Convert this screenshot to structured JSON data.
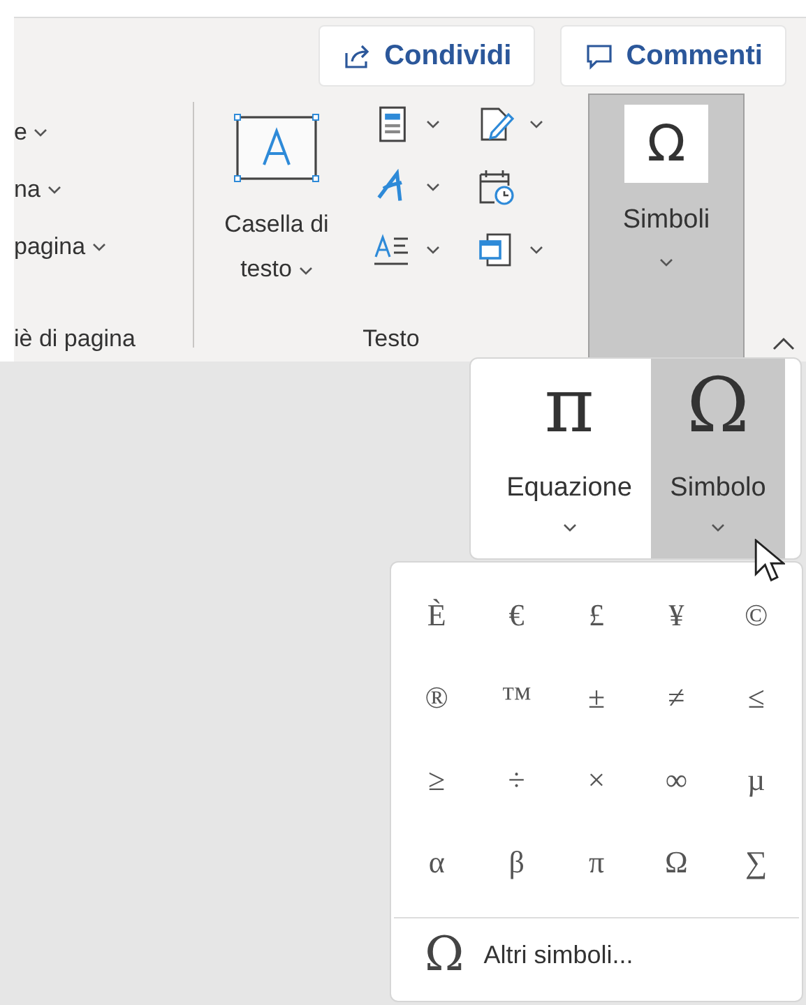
{
  "share_buttons": [
    {
      "kind": "share",
      "label": "Condividi"
    },
    {
      "kind": "comment",
      "label": "Commenti"
    }
  ],
  "ribbon": {
    "cut_group": {
      "items": [
        "e",
        "na",
        "pagina"
      ],
      "label": "iè di pagina"
    },
    "text_group": {
      "text_box": "Casella di testo",
      "label": "Testo"
    },
    "symbols_button": {
      "icon": "Ω",
      "label": "Simboli",
      "selected": true
    }
  },
  "symbols_menu": {
    "items": [
      {
        "icon": "π",
        "label": "Equazione",
        "selected": false
      },
      {
        "icon": "Ω",
        "label": "Simbolo",
        "selected": true
      }
    ]
  },
  "symbol_gallery": {
    "symbols": [
      "È",
      "€",
      "£",
      "¥",
      "©",
      "®",
      "™",
      "±",
      "≠",
      "≤",
      "≥",
      "÷",
      "×",
      "∞",
      "µ",
      "α",
      "β",
      "π",
      "Ω",
      "∑"
    ],
    "more": {
      "icon": "Ω",
      "label": "Altri simboli..."
    }
  }
}
